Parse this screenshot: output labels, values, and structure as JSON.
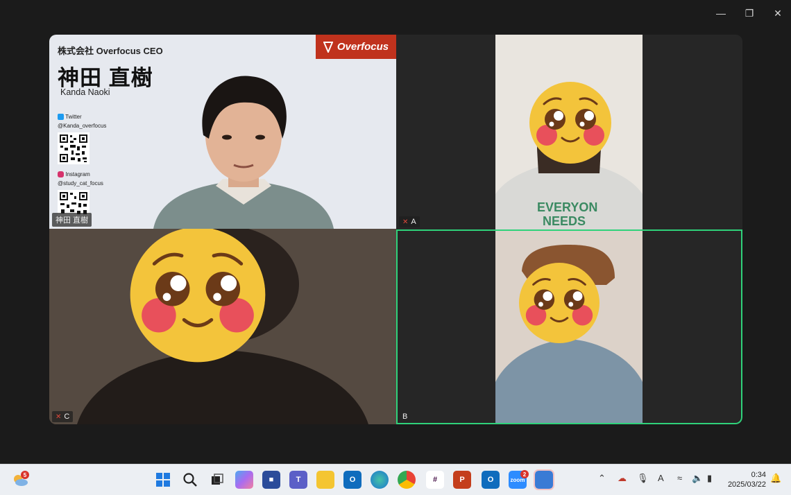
{
  "speaker_card": {
    "company": "株式会社 Overfocus  CEO",
    "name_jp": "神田 直樹",
    "name_romaji": "Kanda Naoki",
    "twitter_label": "Twitter",
    "twitter_handle": "@Kanda_overfocus",
    "instagram_label": "Instagram",
    "instagram_handle": "@study_cat_focus",
    "logo_text": "Overfocus"
  },
  "participants": {
    "speaker": "神田 直樹",
    "a": "A",
    "b": "B",
    "c": "C"
  },
  "taskbar": {
    "weather_badge": "5",
    "zoom_badge": "2",
    "time": "0:34",
    "date": "2025/03/22",
    "ime": "A"
  },
  "colors": {
    "active_speaker_border": "#2fd27a",
    "logo_bg": "#c0321d",
    "mute": "#e0483a"
  }
}
